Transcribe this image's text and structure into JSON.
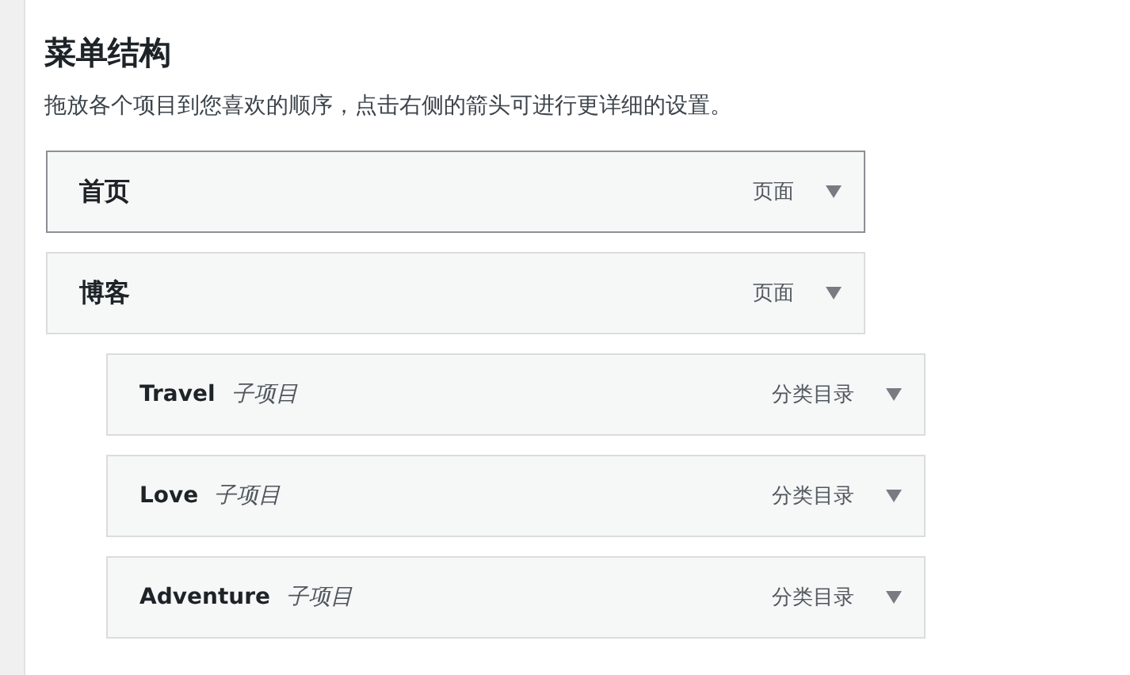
{
  "heading": "菜单结构",
  "description": "拖放各个项目到您喜欢的顺序，点击右侧的箭头可进行更详细的设置。",
  "items": [
    {
      "title": "首页",
      "type": "页面",
      "focused": true
    },
    {
      "title": "博客",
      "type": "页面",
      "focused": false,
      "children": [
        {
          "title": "Travel",
          "sub_label": "子项目",
          "type": "分类目录",
          "focused": false
        },
        {
          "title": "Love",
          "sub_label": "子项目",
          "type": "分类目录",
          "focused": false
        },
        {
          "title": "Adventure",
          "sub_label": "子项目",
          "type": "分类目录",
          "focused": false
        }
      ]
    }
  ]
}
